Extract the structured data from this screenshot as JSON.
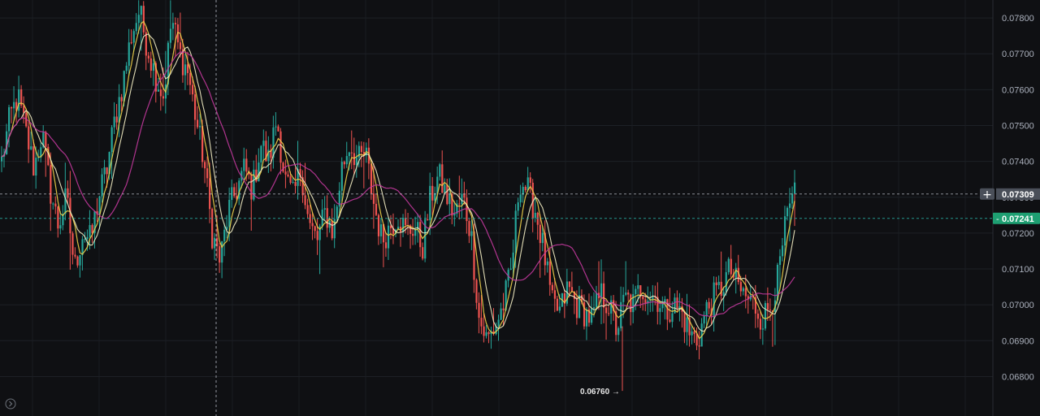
{
  "chart_data": {
    "type": "candlestick",
    "y_ticks": [
      "0.07800",
      "0.07700",
      "0.07600",
      "0.07500",
      "0.07400",
      "0.07300",
      "0.07200",
      "0.07100",
      "0.07000",
      "0.06900",
      "0.06800"
    ],
    "ylim": [
      0.0669,
      0.0785
    ],
    "grid": true,
    "hover_price": {
      "label": "0.07309",
      "value": 0.07309
    },
    "last_price": {
      "label": "0.07241",
      "value": 0.07241
    },
    "low_marker": {
      "label": "0.06760 →",
      "value": 0.0676
    },
    "colors": {
      "background": "#0f1013",
      "up": "#26a69a",
      "down": "#ef5350",
      "ma_fast": "#f3d34a",
      "ma_mid": "#f7f2c7",
      "ma_slow": "#c2399c",
      "last_price_badge": "#1e9f72",
      "hover_badge": "#4a4f59"
    },
    "icons": {
      "crosshair_add": "plus-icon",
      "nav": "chevron-right-circle-icon"
    },
    "price_path": [
      0.074,
      0.0752,
      0.0758,
      0.0748,
      0.0738,
      0.0748,
      0.0732,
      0.0722,
      0.073,
      0.071,
      0.072,
      0.0718,
      0.073,
      0.0738,
      0.0752,
      0.0762,
      0.0775,
      0.0782,
      0.0772,
      0.0764,
      0.0758,
      0.078,
      0.077,
      0.0765,
      0.0752,
      0.074,
      0.072,
      0.0712,
      0.0726,
      0.0732,
      0.0738,
      0.0732,
      0.0745,
      0.074,
      0.0752,
      0.0735,
      0.073,
      0.0738,
      0.0722,
      0.0718,
      0.0726,
      0.072,
      0.0738,
      0.0745,
      0.074,
      0.0742,
      0.0728,
      0.0718,
      0.0722,
      0.0725,
      0.072,
      0.0722,
      0.0716,
      0.073,
      0.0736,
      0.073,
      0.0725,
      0.073,
      0.072,
      0.0696,
      0.069,
      0.0694,
      0.07,
      0.071,
      0.0735,
      0.0732,
      0.0726,
      0.0715,
      0.07,
      0.0698,
      0.0705,
      0.07,
      0.0698,
      0.0696,
      0.0703,
      0.07,
      0.0693,
      0.0702,
      0.07,
      0.0705,
      0.0703,
      0.0702,
      0.0698,
      0.07,
      0.0698,
      0.0692,
      0.069,
      0.0698,
      0.0702,
      0.0705,
      0.071,
      0.0705,
      0.0702,
      0.07,
      0.0696,
      0.07,
      0.0708,
      0.0724,
      0.073
    ]
  }
}
